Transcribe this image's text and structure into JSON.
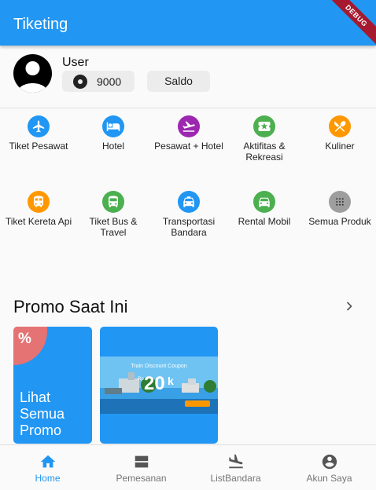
{
  "appbar": {
    "title": "Tiketing",
    "debug_label": "DEBUG"
  },
  "user": {
    "name": "User",
    "points": "9000",
    "saldo_label": "Saldo"
  },
  "menu": [
    {
      "label": "Tiket Pesawat",
      "icon": "flight-icon",
      "color": "#2196f3"
    },
    {
      "label": "Hotel",
      "icon": "hotel-icon",
      "color": "#2196f3"
    },
    {
      "label": "Pesawat + Hotel",
      "icon": "flight-hotel-icon",
      "color": "#9c27b0"
    },
    {
      "label": "Aktifitas & Rekreasi",
      "icon": "activity-icon",
      "color": "#4caf50"
    },
    {
      "label": "Kuliner",
      "icon": "restaurant-icon",
      "color": "#ff9800"
    },
    {
      "label": "Tiket Kereta Api",
      "icon": "train-icon",
      "color": "#ff9800"
    },
    {
      "label": "Tiket Bus & Travel",
      "icon": "bus-icon",
      "color": "#4caf50"
    },
    {
      "label": "Transportasi Bandara",
      "icon": "taxi-icon",
      "color": "#2196f3"
    },
    {
      "label": "Rental Mobil",
      "icon": "car-icon",
      "color": "#4caf50"
    },
    {
      "label": "Semua Produk",
      "icon": "grid-icon",
      "color": "#9e9e9e"
    }
  ],
  "promo": {
    "title": "Promo Saat Ini",
    "badge": "%",
    "see_all": "Lihat Semua Promo",
    "coupon": {
      "heading": "Train Discount Coupon",
      "currency": "Rp",
      "amount": "20",
      "suffix": "k"
    }
  },
  "bottom_nav": [
    {
      "label": "Home",
      "icon": "home-icon",
      "active": true
    },
    {
      "label": "Pemesanan",
      "icon": "orders-icon",
      "active": false
    },
    {
      "label": "ListBandara",
      "icon": "airport-icon",
      "active": false
    },
    {
      "label": "Akun Saya",
      "icon": "account-icon",
      "active": false
    }
  ],
  "colors": {
    "primary": "#2196f3",
    "badge": "#e57373",
    "nav_inactive": "#757575"
  }
}
